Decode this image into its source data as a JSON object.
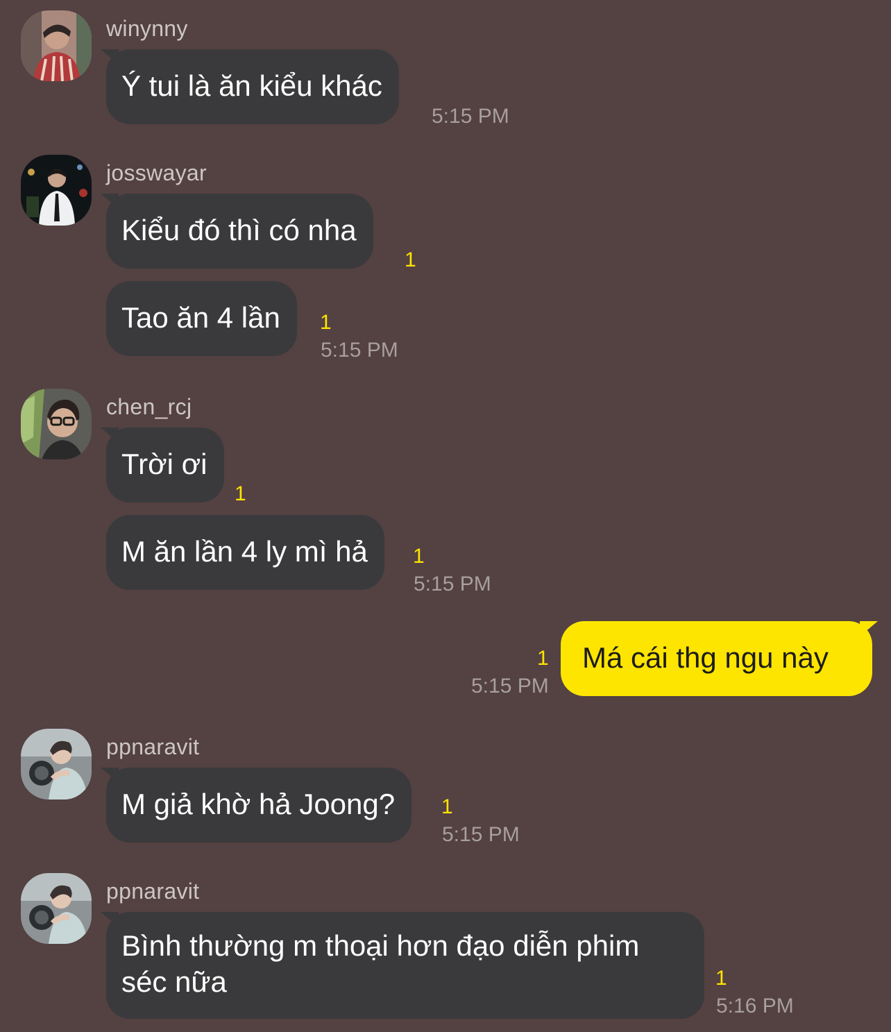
{
  "theme": {
    "background": "#544142",
    "incoming_bubble": "#3a3a3c",
    "outgoing_bubble": "#fee500",
    "unread_color": "#fee500",
    "time_color": "#a89f9f"
  },
  "messages": [
    {
      "sender": "winynny",
      "avatar_icon": "profile-photo",
      "bubbles": [
        {
          "text": "Ý tui là ăn kiểu khác",
          "unread": "",
          "time": "5:15 PM"
        }
      ]
    },
    {
      "sender": "josswayar",
      "avatar_icon": "profile-photo",
      "bubbles": [
        {
          "text": "Kiểu đó thì có nha",
          "unread": "1",
          "time": ""
        },
        {
          "text": "Tao ăn 4 lần",
          "unread": "1",
          "time": "5:15 PM"
        }
      ]
    },
    {
      "sender": "chen_rcj",
      "avatar_icon": "profile-photo",
      "bubbles": [
        {
          "text": "Trời ơi",
          "unread": "1",
          "time": ""
        },
        {
          "text": "M ăn lần 4 ly mì hả",
          "unread": "1",
          "time": "5:15 PM"
        }
      ]
    },
    {
      "sender": "me",
      "outgoing": true,
      "bubbles": [
        {
          "text": "Má cái thg ngu này",
          "unread": "1",
          "time": "5:15 PM"
        }
      ]
    },
    {
      "sender": "ppnaravit",
      "avatar_icon": "profile-photo",
      "bubbles": [
        {
          "text": "M giả khờ hả Joong?",
          "unread": "1",
          "time": "5:15 PM"
        }
      ]
    },
    {
      "sender": "ppnaravit",
      "avatar_icon": "profile-photo",
      "bubbles": [
        {
          "text": "Bình thường m thoại hơn đạo diễn phim séc nữa",
          "unread": "1",
          "time": "5:16 PM"
        }
      ]
    }
  ]
}
